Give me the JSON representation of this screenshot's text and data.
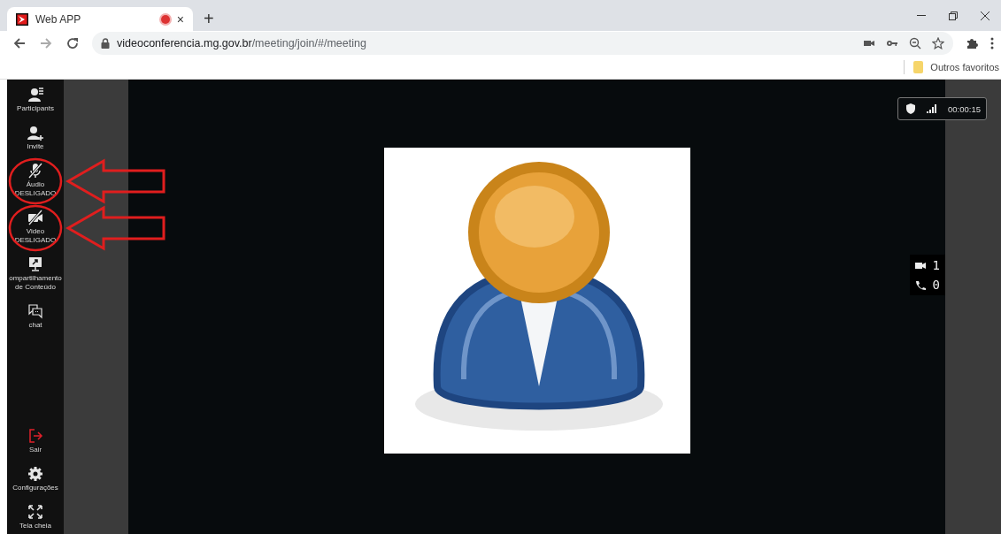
{
  "browser": {
    "tab": {
      "title": "Web APP",
      "recording": true,
      "close": "×"
    },
    "new_tab": "+",
    "address": {
      "host": "videoconferencia.mg.gov.br",
      "path": "/meeting/join/#/meeting"
    },
    "bookmarks": [
      {
        "label": "Outros favoritos"
      }
    ]
  },
  "sidebar": {
    "items": [
      {
        "kind": "participants",
        "label": "Participants",
        "muted": false,
        "highlighted": false
      },
      {
        "kind": "invite",
        "label": "Invite",
        "muted": false,
        "highlighted": false
      },
      {
        "kind": "audio",
        "label": "Áudio DESLIGADO",
        "muted": true,
        "highlighted": true
      },
      {
        "kind": "video",
        "label": "Video DESLIGADO",
        "muted": true,
        "highlighted": true
      },
      {
        "kind": "share",
        "label": "ompartilhamento de Conteúdo",
        "muted": false,
        "highlighted": false
      },
      {
        "kind": "chat",
        "label": "chat",
        "muted": false,
        "highlighted": false
      }
    ],
    "bottom_items": [
      {
        "kind": "exit",
        "label": "Sair"
      },
      {
        "kind": "settings",
        "label": "Configurações"
      },
      {
        "kind": "fullscreen",
        "label": "Tela cheia"
      }
    ]
  },
  "status": {
    "secure": true,
    "duration": "00:00:15"
  },
  "counters": [
    {
      "kind": "video",
      "value": "1"
    },
    {
      "kind": "phone",
      "value": "0"
    }
  ]
}
